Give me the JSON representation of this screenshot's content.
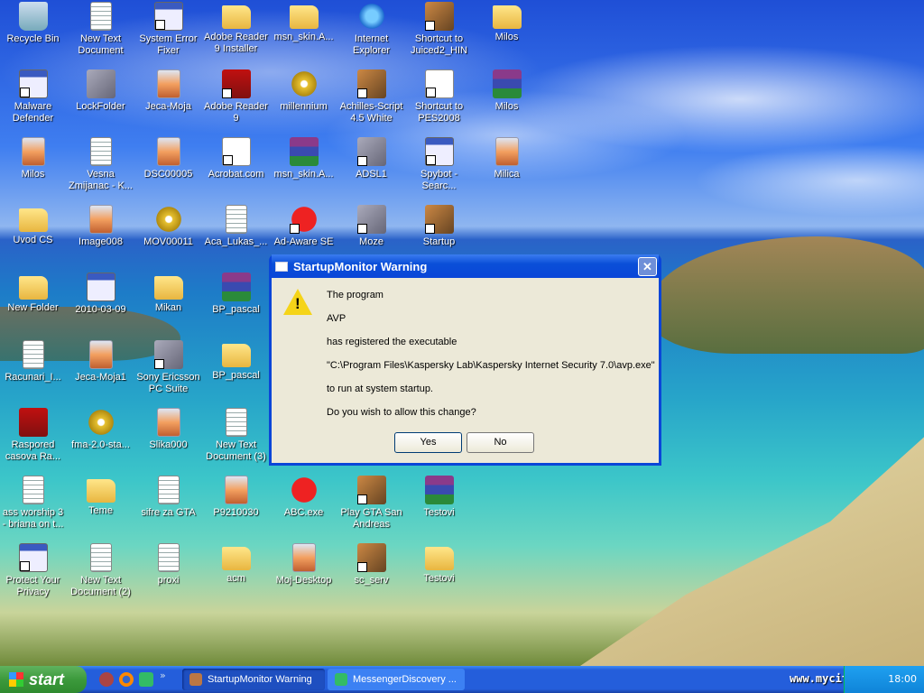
{
  "desktop": {
    "icons": [
      [
        "Recycle Bin",
        "bin",
        0
      ],
      [
        "New Text Document",
        "doc",
        0
      ],
      [
        "System Error Fixer",
        "exe",
        1
      ],
      [
        "Adobe Reader 9 Installer",
        "folder",
        0
      ],
      [
        "msn_skin.A...",
        "folder",
        0
      ],
      [
        "Internet Explorer",
        "ie",
        0
      ],
      [
        "Shortcut to Juiced2_HIN",
        "misc",
        1
      ],
      [
        "Milos",
        "folder",
        0
      ],
      [
        "Malware Defender",
        "exe",
        1
      ],
      [
        "LockFolder",
        "net",
        0
      ],
      [
        "Jeca-Moja",
        "img",
        0
      ],
      [
        "Adobe Reader 9",
        "pdf",
        1
      ],
      [
        "millennium",
        "cd",
        0
      ],
      [
        "Achilles-Script 4.5 White",
        "misc",
        1
      ],
      [
        "Shortcut to PES2008",
        "pdfw",
        1
      ],
      [
        "Milos",
        "rar",
        0
      ],
      [
        "Milos",
        "img",
        0
      ],
      [
        "Vesna Zmijanac - K...",
        "doc",
        0
      ],
      [
        "DSC00005",
        "img",
        0
      ],
      [
        "Acrobat.com",
        "pdfw",
        1
      ],
      [
        "msn_skin.A...",
        "rar",
        0
      ],
      [
        "ADSL1",
        "net",
        1
      ],
      [
        "Spybot - Searc...",
        "exe",
        1
      ],
      [
        "Milica",
        "img",
        0
      ],
      [
        "Uvod CS",
        "folder",
        0
      ],
      [
        "Image008",
        "img",
        0
      ],
      [
        "MOV00011",
        "cd",
        0
      ],
      [
        "Aca_Lukas_...",
        "doc",
        0
      ],
      [
        "Ad-Aware SE",
        "red",
        1
      ],
      [
        "Moze",
        "net",
        1
      ],
      [
        "Startup",
        "misc",
        1
      ],
      null,
      [
        "New Folder",
        "folder",
        0
      ],
      [
        "2010-03-09",
        "exe",
        0
      ],
      [
        "Mikan",
        "folder",
        0
      ],
      [
        "BP_pascal",
        "rar",
        0
      ],
      null,
      null,
      null,
      null,
      [
        "Racunari_I...",
        "doc",
        0
      ],
      [
        "Jeca-Moja1",
        "img",
        0
      ],
      [
        "Sony Ericsson PC Suite",
        "net",
        1
      ],
      [
        "BP_pascal",
        "folder",
        0
      ],
      null,
      null,
      null,
      null,
      [
        "Raspored casova Ra...",
        "pdf",
        0
      ],
      [
        "fma-2.0-sta...",
        "cd",
        0
      ],
      [
        "Slika000",
        "img",
        0
      ],
      [
        "New Text Document (3)",
        "doc",
        0
      ],
      null,
      null,
      null,
      null,
      [
        "ass worship 3 - briana on t...",
        "doc",
        0
      ],
      [
        "Teme",
        "folder",
        0
      ],
      [
        "sifre za GTA",
        "doc",
        0
      ],
      [
        "P9210030",
        "img",
        0
      ],
      [
        "ABC.exe",
        "red",
        0
      ],
      [
        "Play GTA San Andreas",
        "misc",
        1
      ],
      [
        "Testovi",
        "rar",
        0
      ],
      null,
      [
        "Protect Your Privacy",
        "exe",
        1
      ],
      [
        "New Text Document (2)",
        "doc",
        0
      ],
      [
        "proxi",
        "doc",
        0
      ],
      [
        "acm",
        "folder",
        0
      ],
      [
        "Moj-Desktop",
        "img",
        0
      ],
      [
        "sc_serv",
        "misc",
        1
      ],
      [
        "Testovi",
        "folder",
        0
      ],
      null
    ]
  },
  "dialog": {
    "title": "StartupMonitor Warning",
    "close": "✕",
    "icon": "warning-icon",
    "lines": [
      "The program",
      "AVP",
      "has registered the executable",
      "\"C:\\Program Files\\Kaspersky Lab\\Kaspersky Internet Security 7.0\\avp.exe\"",
      "to run at system startup.",
      "Do you wish to allow this change?"
    ],
    "yes": "Yes",
    "no": "No"
  },
  "taskbar": {
    "start": "start",
    "more": "»",
    "tasks": [
      "StartupMonitor Warning",
      "MessengerDiscovery ..."
    ],
    "clock": "18:00",
    "watermark": "www.mycity.co.yu"
  }
}
